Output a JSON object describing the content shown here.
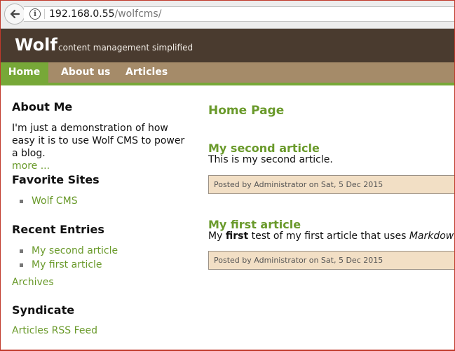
{
  "browser": {
    "url_host": "192.168.0.55",
    "url_path": "/wolfcms/"
  },
  "header": {
    "brand": "Wolf",
    "tagline": "content management simplified"
  },
  "nav": {
    "items": [
      {
        "label": "Home",
        "active": true
      },
      {
        "label": "About us",
        "active": false
      },
      {
        "label": "Articles",
        "active": false
      }
    ]
  },
  "sidebar": {
    "about": {
      "heading": "About Me",
      "text": "I'm just a demonstration of how easy it is to use Wolf CMS to power a blog.",
      "more_link": "more ..."
    },
    "favorites": {
      "heading": "Favorite Sites",
      "items": [
        "Wolf CMS"
      ]
    },
    "recent": {
      "heading": "Recent Entries",
      "items": [
        "My second article",
        "My first article"
      ],
      "archives_link": "Archives"
    },
    "syndicate": {
      "heading": "Syndicate",
      "feed_link": "Articles RSS Feed"
    }
  },
  "main": {
    "page_title": "Home Page",
    "articles": [
      {
        "title": "My second article",
        "body": "This is my second article.",
        "meta": "Posted by Administrator on Sat, 5 Dec 2015"
      },
      {
        "title": "My first article",
        "body_prefix": "My ",
        "body_strong": "first",
        "body_middle": " test of my first article that uses ",
        "body_em": "Markdown",
        "body_suffix": ".",
        "meta": "Posted by Administrator on Sat, 5 Dec 2015"
      }
    ]
  },
  "colors": {
    "header_bg": "#4a3b2f",
    "nav_bg": "#a58b69",
    "accent_green": "#77a838",
    "meta_bg": "#f2dfc5"
  }
}
